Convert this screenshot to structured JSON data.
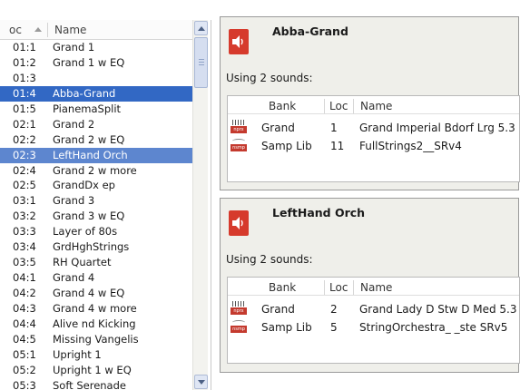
{
  "list": {
    "col_loc": "oc",
    "col_name": "Name",
    "rows": [
      {
        "loc": "01:1",
        "name": "Grand 1"
      },
      {
        "loc": "01:2",
        "name": "Grand 1 w EQ"
      },
      {
        "loc": "01:3",
        "name": ""
      },
      {
        "loc": "01:4",
        "name": "Abba-Grand"
      },
      {
        "loc": "01:5",
        "name": "PianemaSplit"
      },
      {
        "loc": "02:1",
        "name": "Grand 2"
      },
      {
        "loc": "02:2",
        "name": "Grand 2 w EQ"
      },
      {
        "loc": "02:3",
        "name": "LeftHand Orch"
      },
      {
        "loc": "02:4",
        "name": "Grand 2 w more"
      },
      {
        "loc": "02:5",
        "name": "GrandDx ep"
      },
      {
        "loc": "03:1",
        "name": "Grand 3"
      },
      {
        "loc": "03:2",
        "name": "Grand 3 w EQ"
      },
      {
        "loc": "03:3",
        "name": "Layer of 80s"
      },
      {
        "loc": "03:4",
        "name": "GrdHghStrings"
      },
      {
        "loc": "03:5",
        "name": "RH Quartet"
      },
      {
        "loc": "04:1",
        "name": "Grand 4"
      },
      {
        "loc": "04:2",
        "name": "Grand 4 w EQ"
      },
      {
        "loc": "04:3",
        "name": "Grand 4 w more"
      },
      {
        "loc": "04:4",
        "name": "Alive nd Kicking"
      },
      {
        "loc": "04:5",
        "name": "Missing Vangelis"
      },
      {
        "loc": "05:1",
        "name": "Upright 1"
      },
      {
        "loc": "05:2",
        "name": "Upright 1 w EQ"
      },
      {
        "loc": "05:3",
        "name": "Soft Serenade"
      }
    ]
  },
  "panels": [
    {
      "title": "Abba-Grand",
      "using": "Using 2 sounds:",
      "headers": {
        "bank": "Bank",
        "loc": "Loc",
        "name": "Name"
      },
      "sounds": [
        {
          "icon": "nprx",
          "bank": "Grand",
          "loc": "1",
          "name": "Grand Imperial Bdorf Lrg 5.3"
        },
        {
          "icon": "nsmp",
          "bank": "Samp Lib",
          "loc": "11",
          "name": "FullStrings2__SRv4"
        }
      ]
    },
    {
      "title": "LeftHand Orch",
      "using": "Using 2 sounds:",
      "headers": {
        "bank": "Bank",
        "loc": "Loc",
        "name": "Name"
      },
      "sounds": [
        {
          "icon": "nprx",
          "bank": "Grand",
          "loc": "2",
          "name": "Grand Lady D  Stw D  Med 5.3"
        },
        {
          "icon": "nsmp",
          "bank": "Samp Lib",
          "loc": "5",
          "name": "StringOrchestra_ _ste SRv5"
        }
      ]
    }
  ],
  "colors": {
    "selection": "#3268c4",
    "selection_secondary": "#5d86cf",
    "speaker_icon": "#d63a2c",
    "panel_bg": "#efefea"
  }
}
